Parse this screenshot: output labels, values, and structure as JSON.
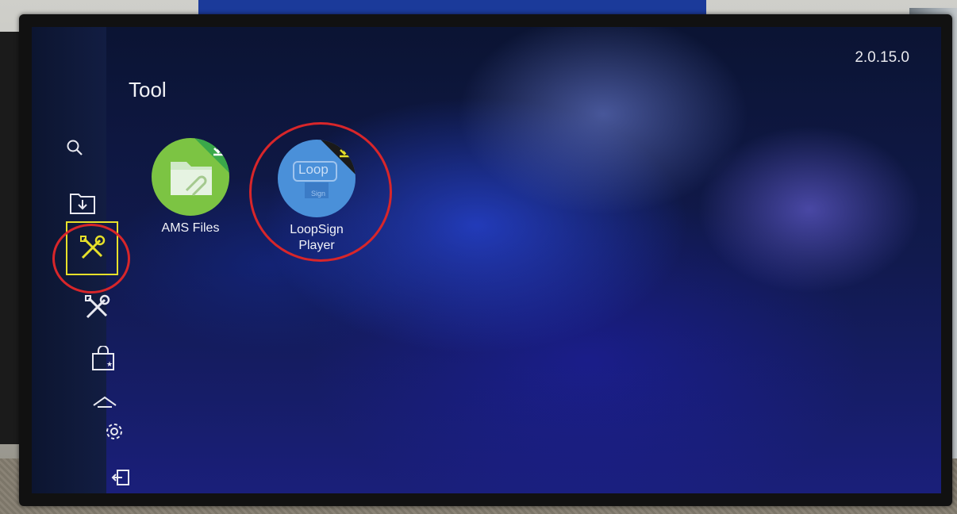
{
  "header": {
    "version": "2.0.15.0",
    "title": "Tool"
  },
  "sidebar": {
    "items": [
      {
        "icon": "search-icon"
      },
      {
        "icon": "download-folder-icon"
      },
      {
        "icon": "tools-icon",
        "active": true
      },
      {
        "icon": "tools-icon"
      },
      {
        "icon": "store-bag-icon"
      },
      {
        "icon": "cast-icon"
      },
      {
        "icon": "gear-icon"
      },
      {
        "icon": "exit-icon"
      }
    ]
  },
  "apps": [
    {
      "label": "AMS Files",
      "icon": "folder-icon",
      "color": "#7cc443"
    },
    {
      "label_line1": "LoopSign",
      "label_line2": "Player",
      "icon": "loopsign-logo",
      "color": "#4a90d9",
      "logo_text": "Loop",
      "logo_subtext": "Sign"
    }
  ],
  "colors": {
    "accent_yellow": "#e6e02a",
    "annotation_red": "#d8262a"
  }
}
